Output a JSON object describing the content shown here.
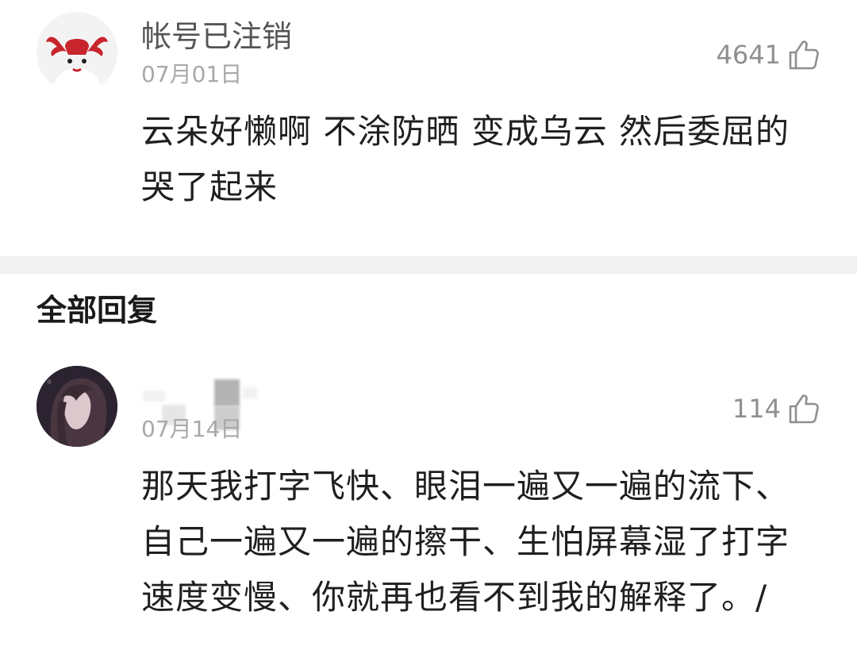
{
  "comments": [
    {
      "username": "帐号已注销",
      "date": "07月01日",
      "likes": "4641",
      "text": "云朵好懒啊  不涂防晒  变成乌云  然后委屈的哭了起来",
      "avatar_icon": "moose-antler-avatar-icon"
    },
    {
      "username": "",
      "date": "07月14日",
      "likes": "114",
      "text": "那天我打字飞快、眼泪一遍又一遍的流下、自己一遍又一遍的擦干、生怕屏幕湿了打字速度变慢、你就再也看不到我的解释了。/",
      "avatar_icon": "anime-girl-avatar-icon"
    }
  ],
  "section_title": "全部回复",
  "colors": {
    "divider": "#f2f2f2",
    "muted_text": "#a8a8a8",
    "username": "#555555",
    "antler_red": "#c8252c"
  }
}
